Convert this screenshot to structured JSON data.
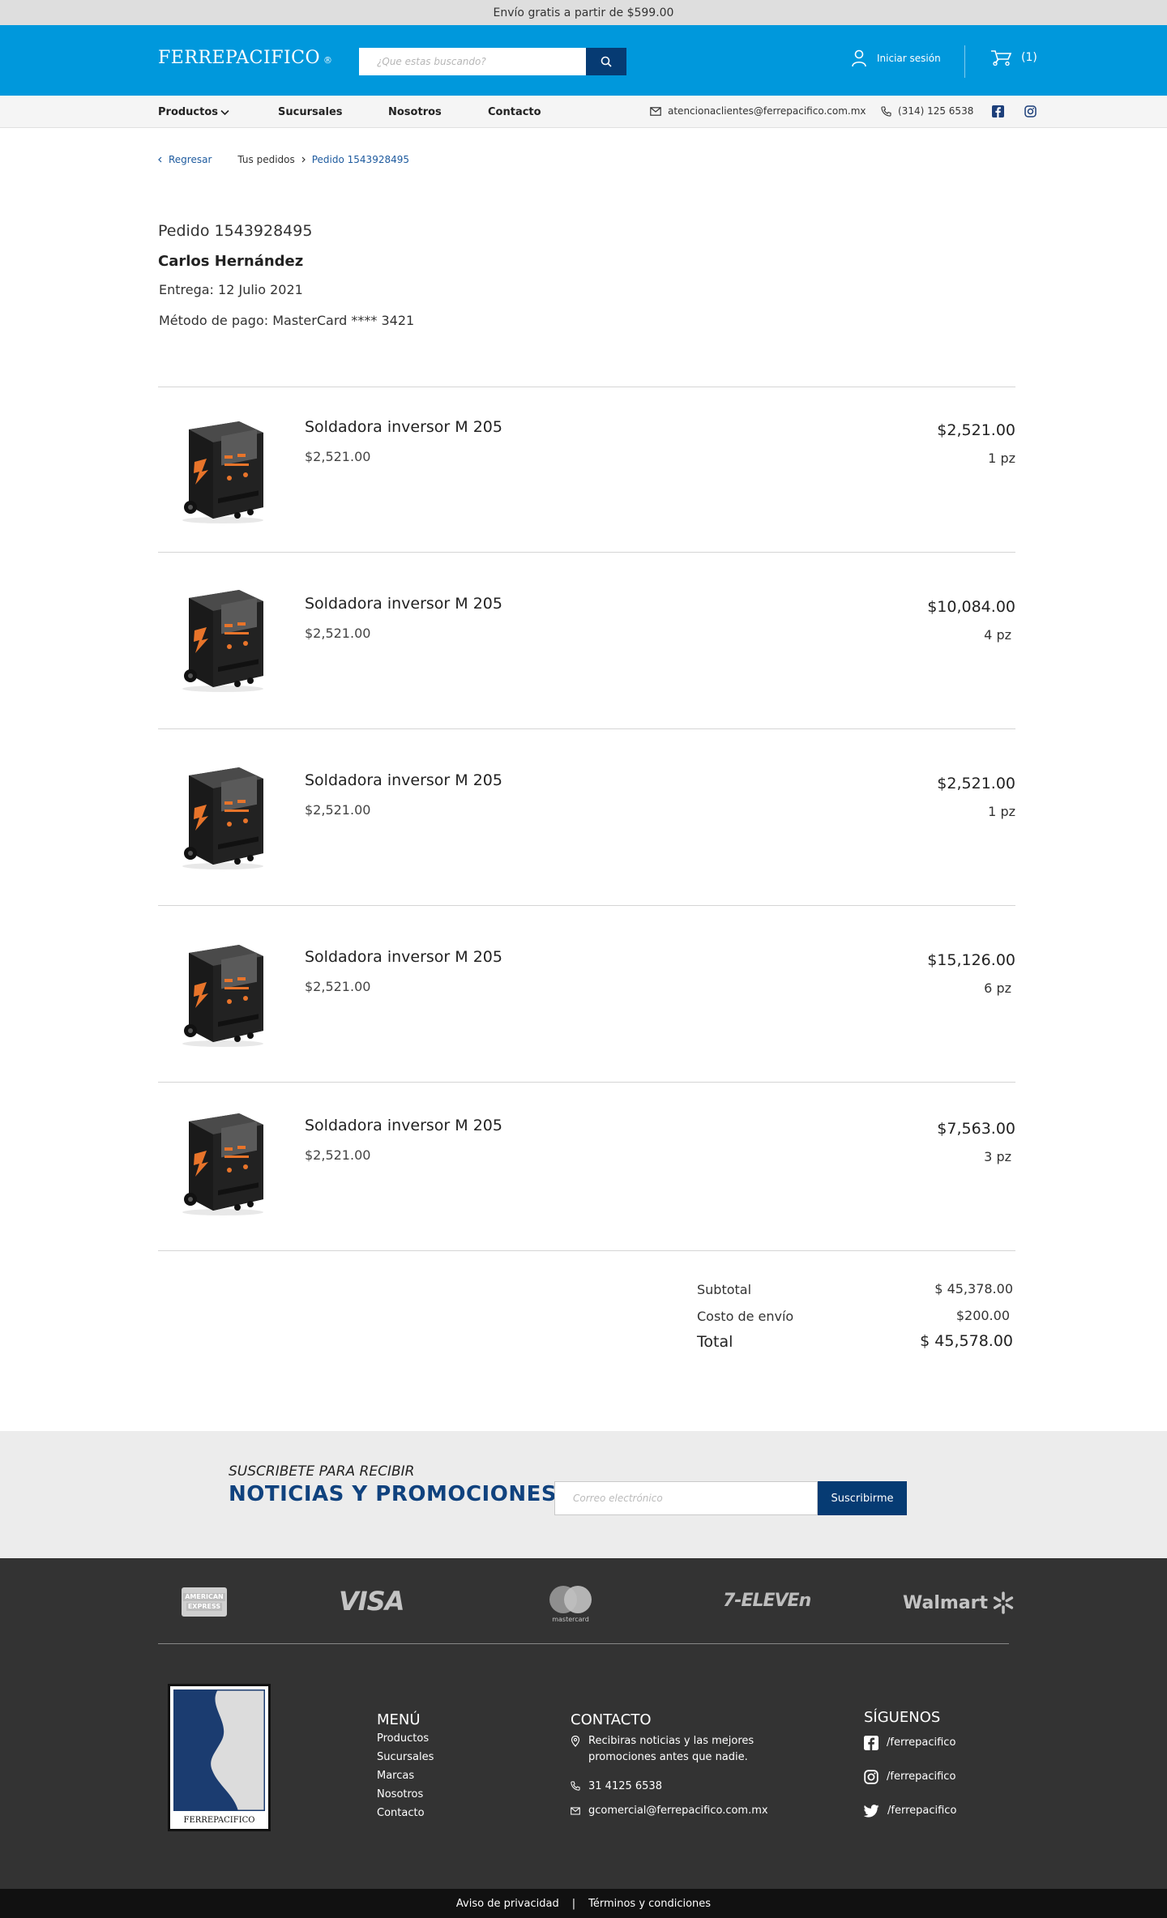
{
  "promo": {
    "text": "Envío gratis a partir de $599.00"
  },
  "header": {
    "logo": "FERREPACIFICO",
    "logo_mark": "®",
    "search_placeholder": "¿Que estas buscando?",
    "login_label": "Iniciar sesión",
    "cart_count": "(1)"
  },
  "nav": {
    "items": [
      "Productos",
      "Sucursales",
      "Nosotros",
      "Contacto"
    ],
    "email": "atencionaclientes@ferrepacifico.com.mx",
    "phone": "(314) 125 6538"
  },
  "breadcrumb": {
    "back": "Regresar",
    "orders": "Tus pedidos",
    "current": "Pedido 1543928495"
  },
  "order": {
    "title": "Pedido 1543928495",
    "customer": "Carlos Hernández",
    "delivery": "Entrega: 12 Julio 2021",
    "payment": "Método de pago: MasterCard **** 3421"
  },
  "items": [
    {
      "name": "Soldadora inversor M 205",
      "unit_price": "$2,521.00",
      "total": "$2,521.00",
      "qty": "1 pz"
    },
    {
      "name": "Soldadora inversor M 205",
      "unit_price": "$2,521.00",
      "total": "$10,084.00",
      "qty": "4 pz"
    },
    {
      "name": "Soldadora inversor M 205",
      "unit_price": "$2,521.00",
      "total": "$2,521.00",
      "qty": "1 pz"
    },
    {
      "name": "Soldadora inversor M 205",
      "unit_price": "$2,521.00",
      "total": "$15,126.00",
      "qty": "6 pz"
    },
    {
      "name": "Soldadora inversor M 205",
      "unit_price": "$2,521.00",
      "total": "$7,563.00",
      "qty": "3 pz"
    }
  ],
  "summary": {
    "subtotal_label": "Subtotal",
    "subtotal": "$ 45,378.00",
    "shipping_label": "Costo de envío",
    "shipping": "$200.00",
    "total_label": "Total",
    "total": "$ 45,578.00"
  },
  "newsletter": {
    "pre": "SUSCRIBETE PARA RECIBIR",
    "title": "NOTICIAS Y PROMOCIONES",
    "placeholder": "Correo electrónico",
    "button": "Suscribirme"
  },
  "payments": {
    "amex_top": "AMERICAN",
    "amex_bottom": "EXPRESS",
    "visa": "VISA",
    "mastercard": "mastercard",
    "seven": "7-ELEVEn",
    "walmart": "Walmart"
  },
  "footer": {
    "logo_text": "FERREPACIFICO",
    "menu_heading": "MENÚ",
    "menu": [
      "Productos",
      "Sucursales",
      "Marcas",
      "Nosotros",
      "Contacto"
    ],
    "contact_heading": "CONTACTO",
    "contact_news": "Recibiras noticias y las mejores promociones antes que nadie.",
    "contact_phone": "31 4125 6538",
    "contact_email": "gcomercial@ferrepacifico.com.mx",
    "social_heading": "SÍGUENOS",
    "facebook": "/ferrepacifico",
    "instagram": "/ferrepacifico",
    "twitter": "/ferrepacifico"
  },
  "bottom": {
    "privacy": "Aviso de privacidad",
    "separator": "|",
    "terms": "Términos y condiciones"
  },
  "colors": {
    "header": "#0098dc",
    "navy": "#063b73",
    "footer": "#333333"
  }
}
